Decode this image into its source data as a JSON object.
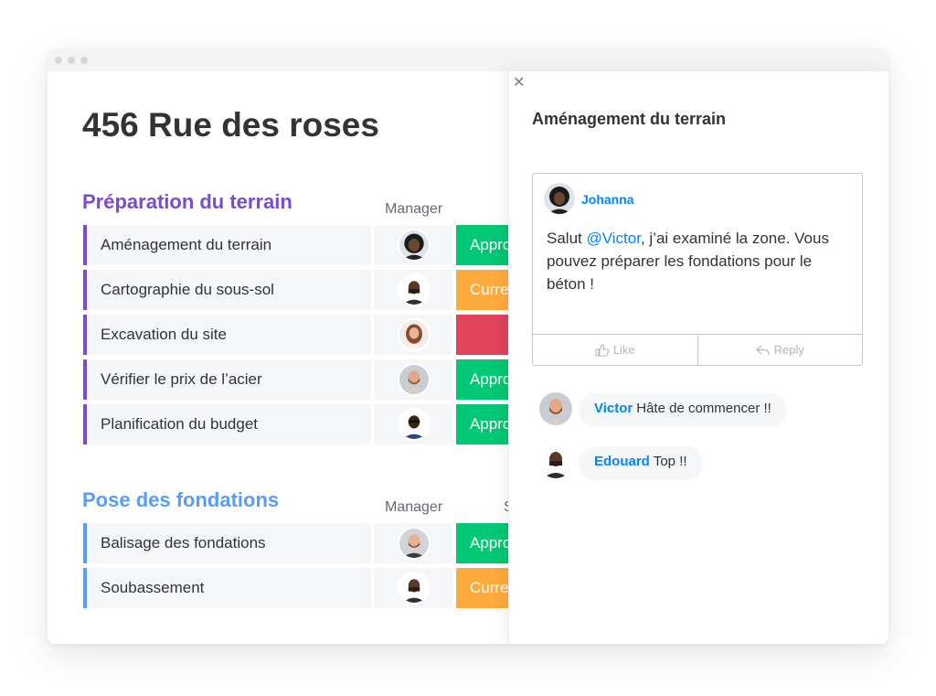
{
  "board": {
    "title": "456 Rue des roses",
    "groups": [
      {
        "title": "Préparation du terrain",
        "title_color": "#784bd1",
        "column_header": "Manager",
        "items": [
          {
            "name": "Aménagement du terrain",
            "status_label": "Approuvé",
            "status_color": "#00c875",
            "manager_icon": "avatar-woman-curly-hair"
          },
          {
            "name": "Cartographie du sous-sol",
            "status_label": "Currently",
            "status_color": "#fdab3d",
            "manager_icon": "avatar-man-bald"
          },
          {
            "name": "Excavation du site",
            "status_label": "",
            "status_color": "#e2445c",
            "manager_icon": "avatar-woman-long-hair"
          },
          {
            "name": "Vérifier le prix de l’acier",
            "status_label": "Approuvé",
            "status_color": "#00c875",
            "manager_icon": "avatar-man-beard"
          },
          {
            "name": "Planification du budget",
            "status_label": "Approuvé",
            "status_color": "#00c875",
            "manager_icon": "avatar-man-glasses"
          }
        ]
      },
      {
        "title": "Pose des fondations",
        "title_color": "#579bfc",
        "column_header": "Manager",
        "column_header_partial": "S",
        "items": [
          {
            "name": "Balisage des fondations",
            "status_label": "Approuvé",
            "status_color": "#00c875",
            "manager_icon": "avatar-man-beard-light"
          },
          {
            "name": "Soubassement",
            "status_label": "Currently",
            "status_color": "#fdab3d",
            "manager_icon": "avatar-man-bald"
          }
        ]
      }
    ]
  },
  "panel": {
    "title": "Aménagement du terrain",
    "close_icon": "close-icon",
    "update": {
      "author": "Johanna",
      "body_before": "Salut ",
      "mention": "@Victor",
      "body_after": ", j’ai examiné la zone. Vous pouvez préparer les fondations pour le béton !",
      "like_label": "Like",
      "reply_label": "Reply"
    },
    "replies": [
      {
        "author": "Victor",
        "text": "Hâte de commencer !!"
      },
      {
        "author": "Edouard",
        "text": "Top !!"
      }
    ]
  },
  "colors": {
    "accent_blue": "#0085ff",
    "group_purple": "#784bd1",
    "group_blue": "#579bfc",
    "status_green": "#00c875",
    "status_orange": "#fdab3d",
    "status_red": "#e2445c"
  }
}
